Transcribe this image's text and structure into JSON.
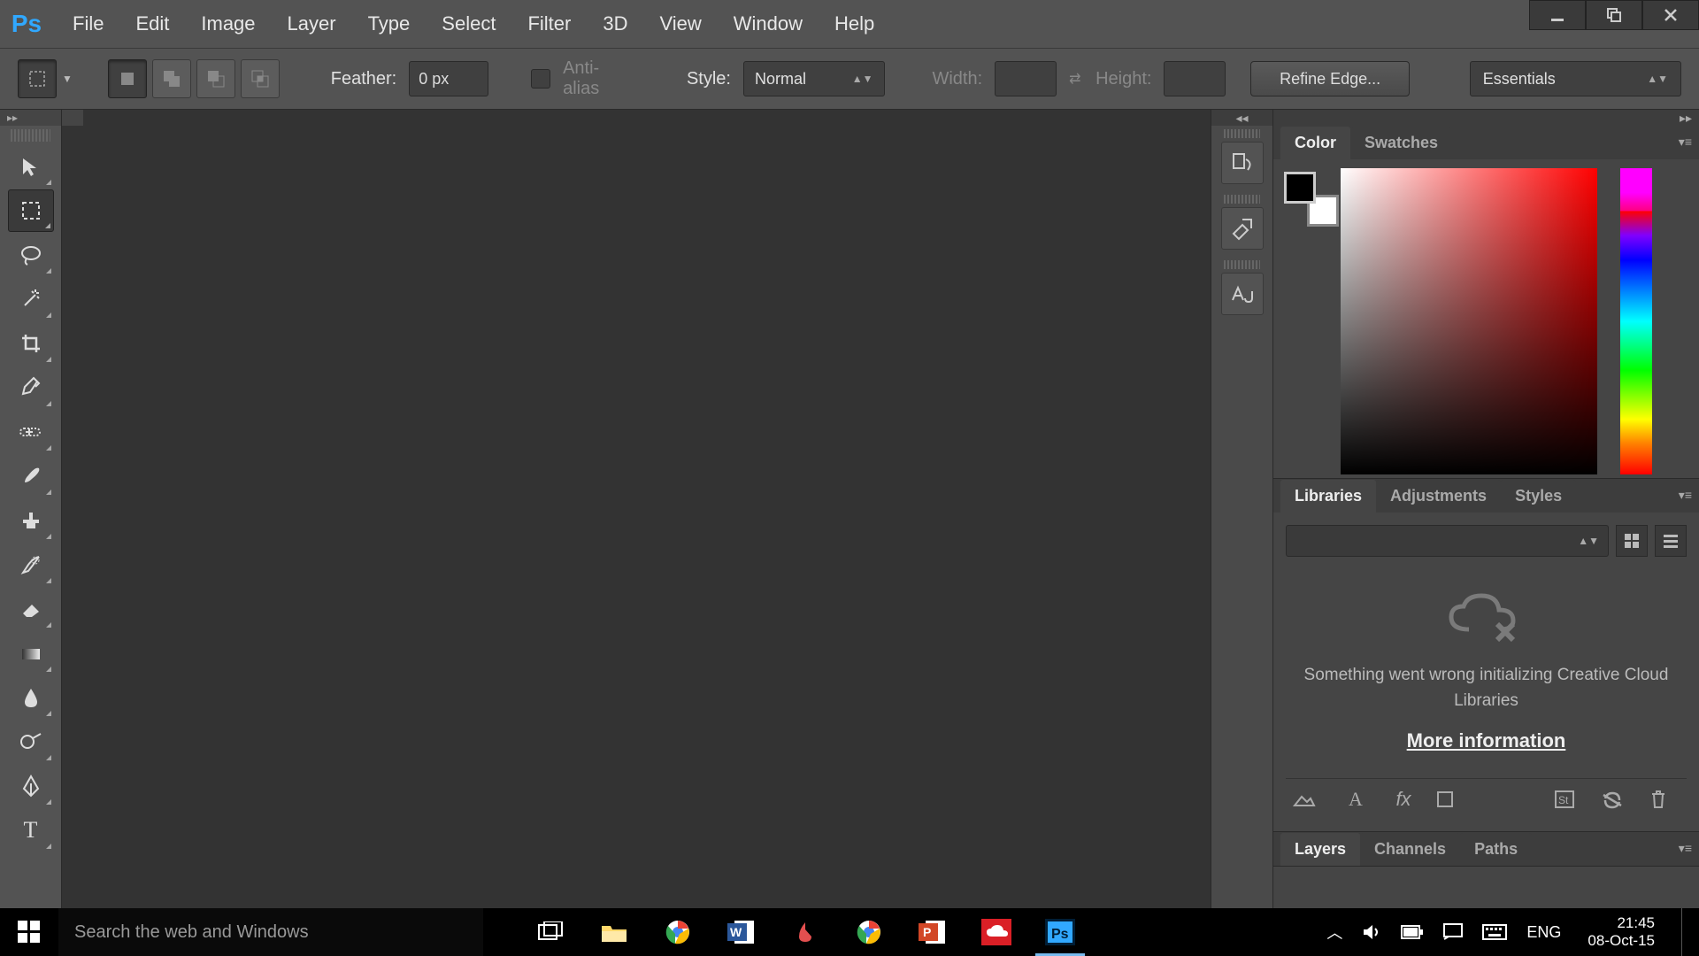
{
  "menu": {
    "items": [
      "File",
      "Edit",
      "Image",
      "Layer",
      "Type",
      "Select",
      "Filter",
      "3D",
      "View",
      "Window",
      "Help"
    ]
  },
  "options": {
    "feather_label": "Feather:",
    "feather_value": "0 px",
    "antialias_label": "Anti-alias",
    "style_label": "Style:",
    "style_value": "Normal",
    "width_label": "Width:",
    "width_value": "",
    "height_label": "Height:",
    "height_value": "",
    "refine": "Refine Edge...",
    "workspace": "Essentials"
  },
  "panels": {
    "color_tabs": [
      "Color",
      "Swatches"
    ],
    "lib_tabs": [
      "Libraries",
      "Adjustments",
      "Styles"
    ],
    "layer_tabs": [
      "Layers",
      "Channels",
      "Paths"
    ],
    "lib_msg": "Something went wrong initializing Creative Cloud Libraries",
    "lib_link": "More information"
  },
  "taskbar": {
    "search_placeholder": "Search the web and Windows",
    "lang": "ENG",
    "time": "21:45",
    "date": "08-Oct-15"
  }
}
